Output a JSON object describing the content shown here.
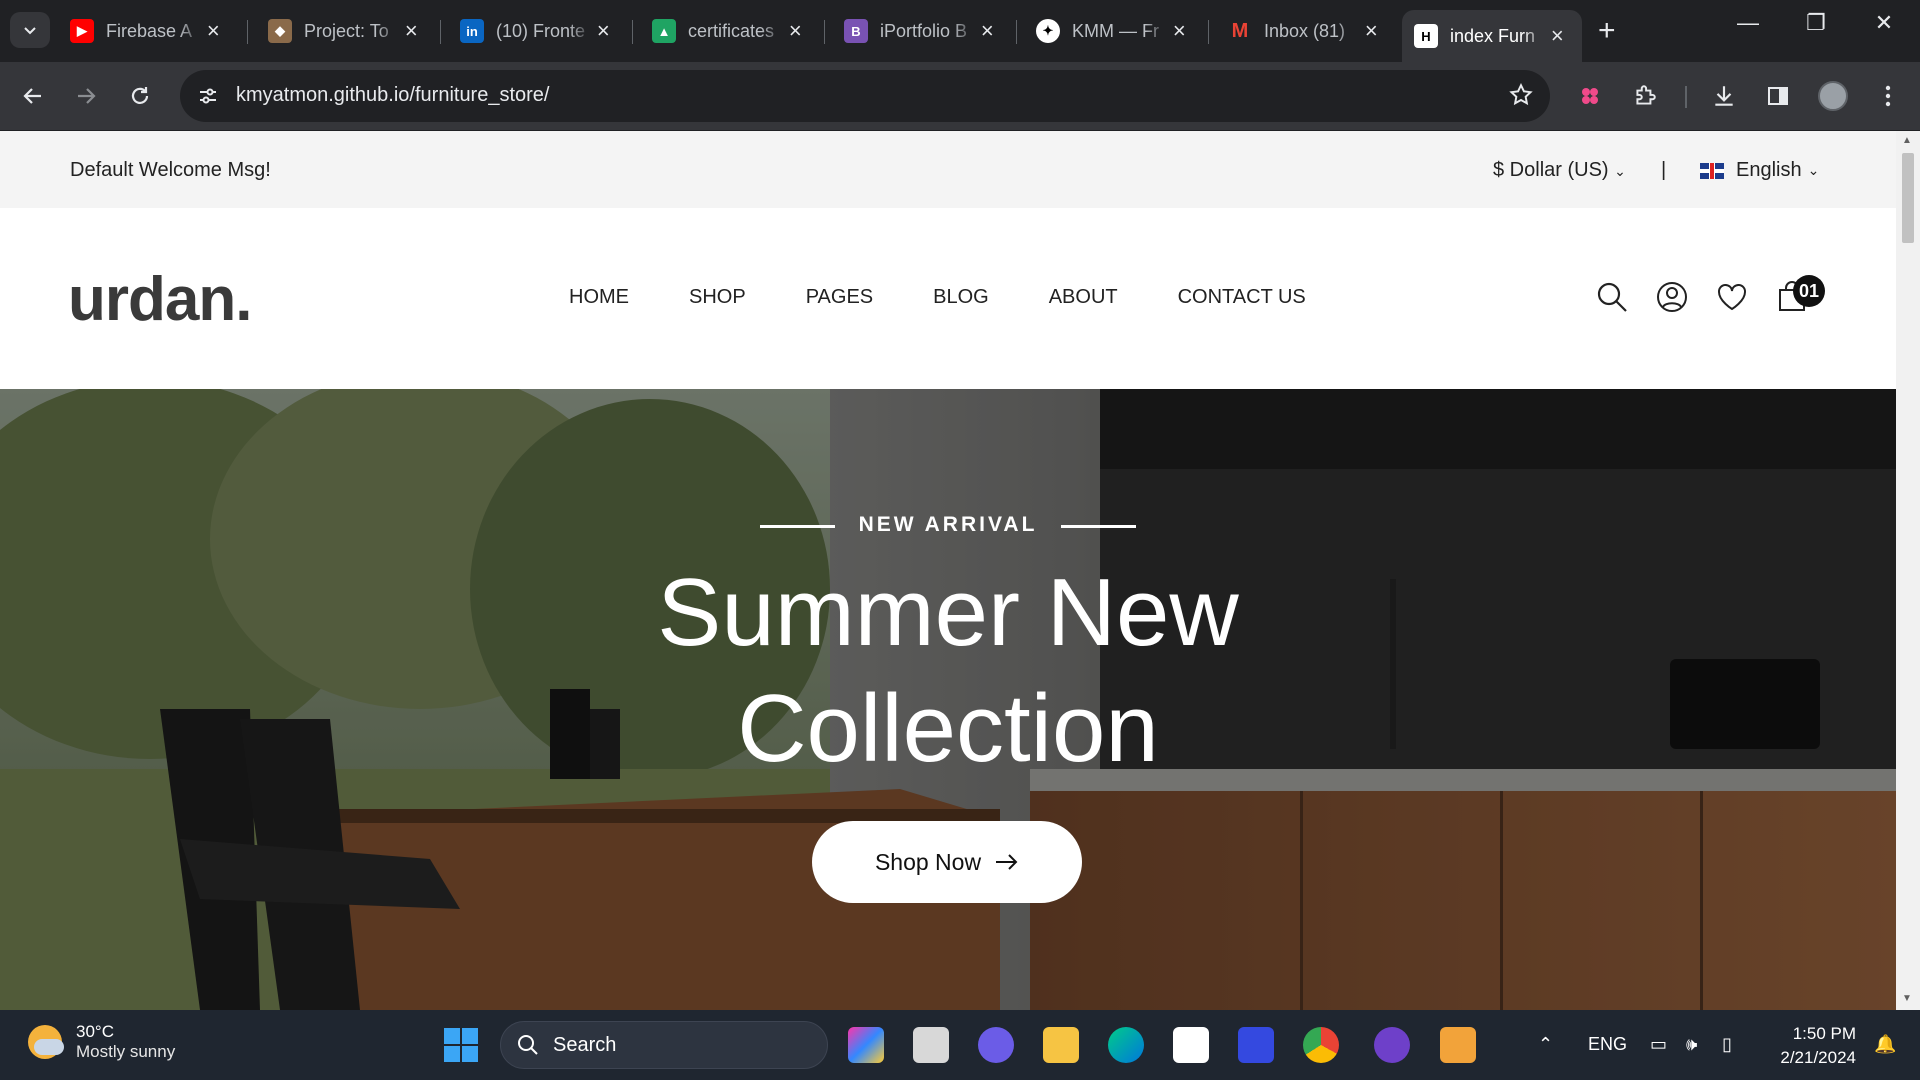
{
  "browser": {
    "tabs": [
      {
        "title": "Firebase A",
        "favicon": "youtube-icon",
        "color": "#ff0000"
      },
      {
        "title": "Project: To",
        "favicon": "fox-icon",
        "color": "#8a6a4a"
      },
      {
        "title": "(10) Fronte",
        "favicon": "linkedin-icon",
        "color": "#0a66c2"
      },
      {
        "title": "certificates",
        "favicon": "google-drive-icon",
        "color": "#1fa463"
      },
      {
        "title": "iPortfolio B",
        "favicon": "bootstrap-icon",
        "color": "#7952b3"
      },
      {
        "title": "KMM — Fr",
        "favicon": "kmm-icon",
        "color": "#ffffff"
      },
      {
        "title": "Inbox (81)",
        "favicon": "gmail-icon",
        "color": "#ea4335"
      },
      {
        "title": "index Furn",
        "favicon": "h-icon",
        "color": "#ffffff"
      }
    ],
    "active_tab_index": 7,
    "url": "kmyatmon.github.io/furniture_store/"
  },
  "topbar": {
    "welcome": "Default Welcome Msg!",
    "currency": "$ Dollar (US)",
    "separator": "|",
    "language": "English"
  },
  "header": {
    "logo": "urdan.",
    "menu": [
      "HOME",
      "SHOP",
      "PAGES",
      "BLOG",
      "ABOUT",
      "CONTACT US"
    ],
    "cart_count": "01"
  },
  "hero": {
    "eyebrow": "NEW ARRIVAL",
    "headline_line1": "Summer New",
    "headline_line2": "Collection",
    "cta": "Shop Now"
  },
  "taskbar": {
    "weather_temp": "30°C",
    "weather_desc": "Mostly sunny",
    "search_placeholder": "Search",
    "lang": "ENG",
    "time": "1:50 PM",
    "date": "2/21/2024"
  }
}
